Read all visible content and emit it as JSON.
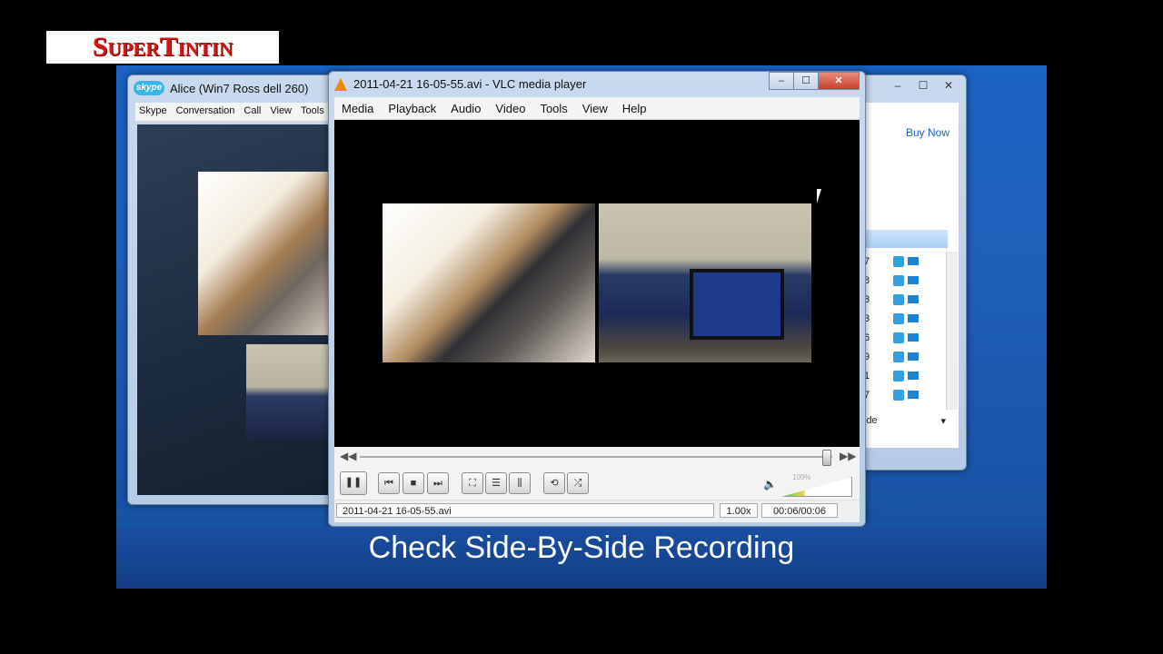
{
  "logo": {
    "text": "SuperTintin"
  },
  "caption": "Check Side-By-Side Recording",
  "skype": {
    "logo_text": "skype",
    "title": "Alice (Win7 Ross dell 260)",
    "menu": [
      "Skype",
      "Conversation",
      "Call",
      "View",
      "Tools"
    ]
  },
  "side_panel": {
    "buy_now": "Buy Now",
    "rows": [
      "7",
      "8",
      "8",
      "3",
      "6",
      "9",
      "1",
      "7"
    ],
    "select_text": "ide"
  },
  "vlc": {
    "title": "2011-04-21 16-05-55.avi - VLC media player",
    "window_buttons": {
      "minimize": "–",
      "maximize": "☐",
      "close": "✕"
    },
    "menu": [
      "Media",
      "Playback",
      "Audio",
      "Video",
      "Tools",
      "View",
      "Help"
    ],
    "progress": 0.99,
    "volume_label": "100%",
    "volume": 1.0,
    "status": {
      "filename": "2011-04-21 16-05-55.avi",
      "rate": "1.00x",
      "time": "00:06/00:06"
    }
  },
  "colors": {
    "desktop": "#1b63c4",
    "vlc_orange": "#f08a00",
    "skype_blue": "#38b6ea"
  }
}
